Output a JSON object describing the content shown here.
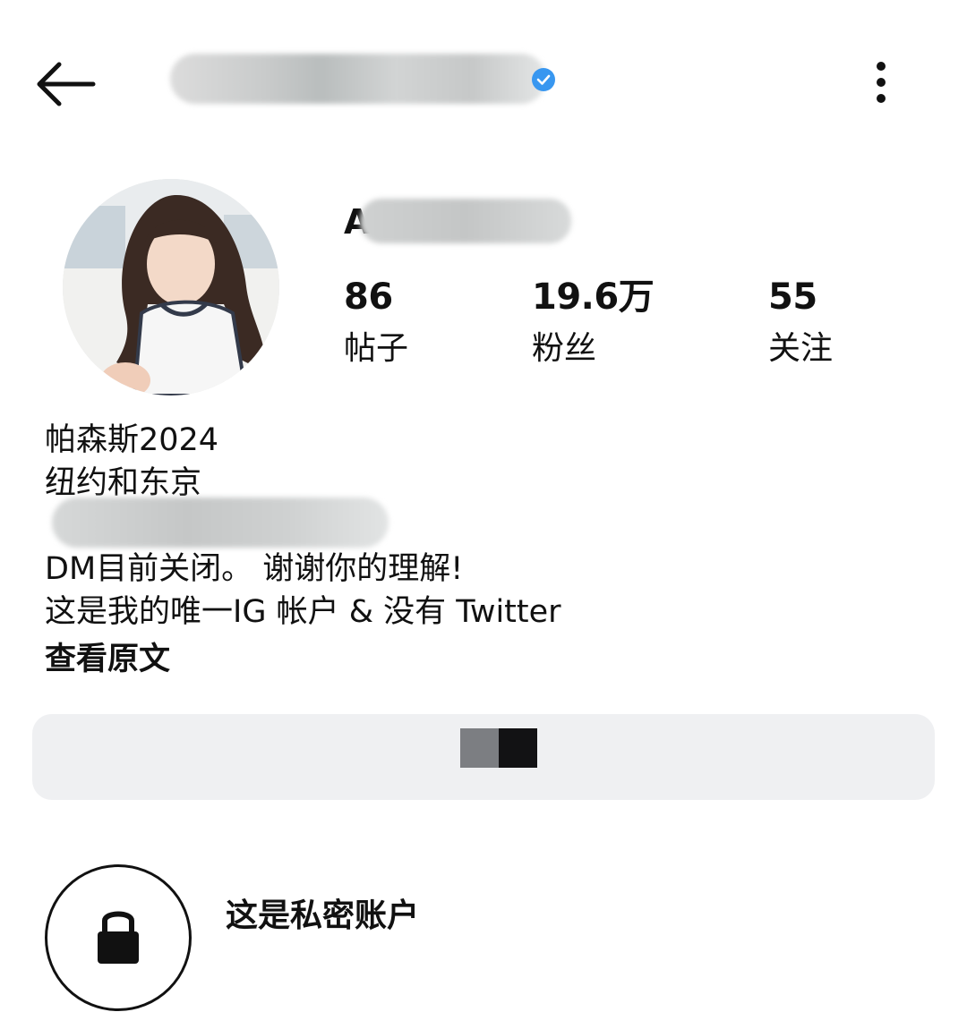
{
  "header": {
    "back_icon": "arrow-left-icon",
    "more_icon": "more-vertical-icon",
    "verified_color": "#3897f0"
  },
  "profile": {
    "name_visible_prefix": "A",
    "stats": [
      {
        "value": "86",
        "label": "帖子"
      },
      {
        "value": "19.6万",
        "label": "粉丝"
      },
      {
        "value": "55",
        "label": "关注"
      }
    ]
  },
  "bio": {
    "line1": "帕森斯2024",
    "line2": "纽约和东京",
    "line4": "DM目前关闭。 谢谢你的理解!",
    "line5": "这是我的唯一IG 帐户 & 没有 Twitter",
    "see_original": "查看原文"
  },
  "private_account": {
    "title": "这是私密账户",
    "icon": "lock-icon"
  },
  "colors": {
    "button_bg": "#eff0f2",
    "text": "#111111",
    "accent": "#3897f0"
  }
}
